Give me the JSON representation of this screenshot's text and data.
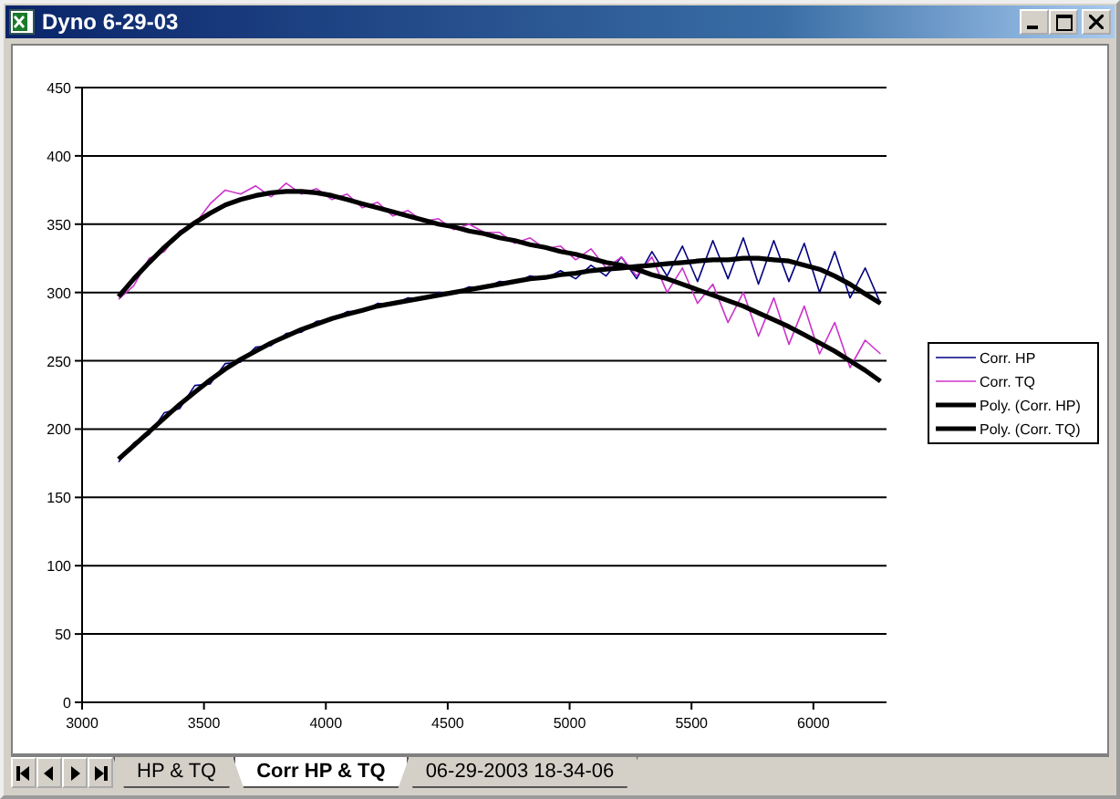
{
  "window": {
    "title": "Dyno 6-29-03"
  },
  "chart": {
    "chart_data": {
      "type": "line",
      "grid": true,
      "legend": true,
      "xlim": [
        3000,
        6300
      ],
      "ylim": [
        0,
        450
      ],
      "xticks": [
        3000,
        3500,
        4000,
        4500,
        5000,
        5500,
        6000
      ],
      "yticks": [
        0,
        50,
        100,
        150,
        200,
        250,
        300,
        350,
        400,
        450
      ],
      "x": [
        3150,
        3212.5,
        3275,
        3337.5,
        3400,
        3462.5,
        3525,
        3587.5,
        3650,
        3712.5,
        3775,
        3837.5,
        3900,
        3962.5,
        4025,
        4087.5,
        4150,
        4212.5,
        4275,
        4337.5,
        4400,
        4462.5,
        4525,
        4587.5,
        4650,
        4712.5,
        4775,
        4837.5,
        4900,
        4962.5,
        5025,
        5087.5,
        5150,
        5212.5,
        5275,
        5337.5,
        5400,
        5462.5,
        5525,
        5587.5,
        5650,
        5712.5,
        5775,
        5837.5,
        5900,
        5962.5,
        6025,
        6087.5,
        6150,
        6212.5,
        6275
      ],
      "series": [
        {
          "name": "Corr. HP",
          "color": "#000080",
          "values": [
            176,
            190,
            196,
            212,
            215,
            232,
            233,
            248,
            249,
            260,
            261,
            270,
            271,
            279,
            280,
            286,
            286,
            292,
            291,
            296,
            295,
            300,
            299,
            304,
            303,
            308,
            307,
            312,
            310,
            316,
            310,
            320,
            312,
            326,
            310,
            330,
            312,
            334,
            308,
            338,
            310,
            340,
            306,
            338,
            308,
            336,
            300,
            330,
            296,
            318,
            292
          ]
        },
        {
          "name": "Corr. TQ",
          "color": "#cc33cc",
          "values": [
            295,
            305,
            325,
            330,
            345,
            350,
            365,
            375,
            372,
            378,
            370,
            380,
            372,
            376,
            368,
            372,
            362,
            366,
            356,
            360,
            352,
            354,
            346,
            350,
            344,
            344,
            336,
            340,
            332,
            334,
            324,
            332,
            318,
            326,
            312,
            326,
            300,
            318,
            292,
            306,
            278,
            300,
            268,
            296,
            262,
            290,
            255,
            278,
            245,
            265,
            255
          ]
        },
        {
          "name": "Poly. (Corr. HP)",
          "color": "#000000",
          "values": [
            178,
            188,
            198,
            208,
            218,
            227,
            236,
            244,
            251,
            257,
            263,
            268,
            273,
            277,
            281,
            284,
            287,
            290,
            292,
            294,
            296,
            298,
            300,
            302,
            304,
            306,
            308,
            310,
            311,
            313,
            314,
            316,
            317,
            318,
            319,
            320,
            321,
            322,
            323,
            324,
            324,
            325,
            325,
            324,
            323,
            320,
            317,
            312,
            306,
            299,
            292
          ]
        },
        {
          "name": "Poly. (Corr. TQ)",
          "color": "#000000",
          "values": [
            297,
            310,
            322,
            333,
            343,
            351,
            358,
            364,
            368,
            371,
            373,
            374,
            374,
            373,
            371,
            368,
            365,
            362,
            359,
            356,
            353,
            350,
            348,
            345,
            343,
            340,
            338,
            335,
            333,
            330,
            328,
            325,
            322,
            320,
            317,
            313,
            310,
            306,
            302,
            298,
            294,
            290,
            285,
            280,
            275,
            269,
            263,
            257,
            250,
            243,
            235
          ]
        }
      ]
    }
  },
  "sheet_tabs": [
    {
      "label": "HP & TQ",
      "selected": false
    },
    {
      "label": "Corr HP & TQ",
      "selected": true
    },
    {
      "label": "06-29-2003 18-34-06",
      "selected": false
    }
  ]
}
